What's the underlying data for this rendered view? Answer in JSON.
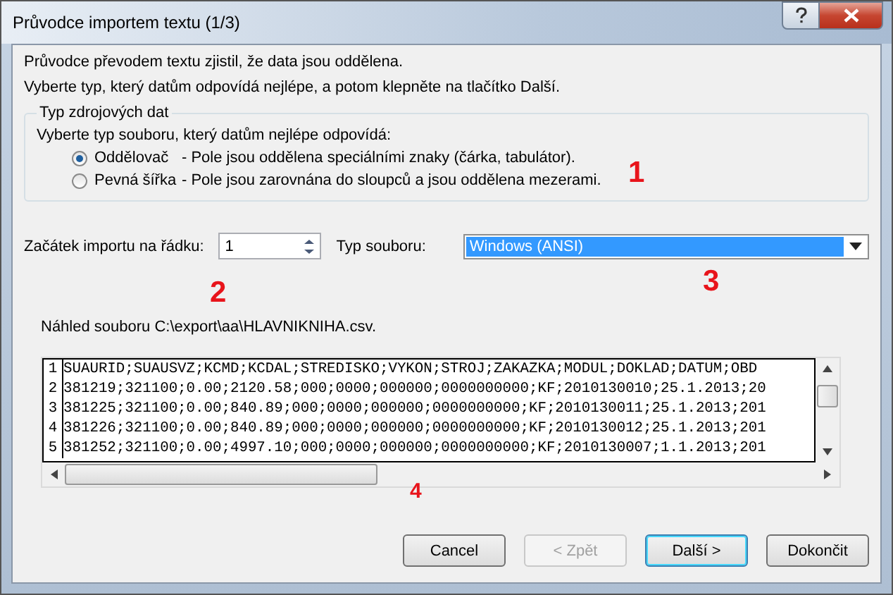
{
  "window": {
    "title": "Průvodce importem textu (1/3)"
  },
  "intro": [
    "Průvodce převodem textu zjistil, že data jsou oddělena.",
    "Vyberte typ, který datům odpovídá nejlépe, a potom klepněte na tlačítko Další."
  ],
  "source_group": {
    "legend": "Typ zdrojových dat",
    "prompt": "Vyberte typ souboru, který datům nejlépe odpovídá:",
    "options": [
      {
        "label": "Oddělovač",
        "description": "- Pole jsou oddělena speciálními znaky (čárka, tabulátor).",
        "selected": true
      },
      {
        "label": "Pevná šířka",
        "description": "- Pole jsou zarovnána do sloupců a jsou oddělena mezerami.",
        "selected": false
      }
    ]
  },
  "start_row": {
    "label": "Začátek importu na řádku:",
    "value": "1"
  },
  "file_type": {
    "label": "Typ souboru:",
    "value": "Windows (ANSI)"
  },
  "preview": {
    "label": "Náhled souboru C:\\export\\aa\\HLAVNIKNIHA.csv.",
    "lines": [
      {
        "number": "1",
        "text": "SUAURID;SUAUSVZ;KCMD;KCDAL;STREDISKO;VYKON;STROJ;ZAKAZKA;MODUL;DOKLAD;DATUM;OBD"
      },
      {
        "number": "2",
        "text": "381219;321100;0.00;2120.58;000;0000;000000;0000000000;KF;2010130010;25.1.2013;20"
      },
      {
        "number": "3",
        "text": "381225;321100;0.00;840.89;000;0000;000000;0000000000;KF;2010130011;25.1.2013;201"
      },
      {
        "number": "4",
        "text": "381226;321100;0.00;840.89;000;0000;000000;0000000000;KF;2010130012;25.1.2013;201"
      },
      {
        "number": "5",
        "text": "381252;321100;0.00;4997.10;000;0000;000000;0000000000;KF;2010130007;1.1.2013;201"
      }
    ]
  },
  "buttons": [
    {
      "label": "Cancel",
      "disabled": false,
      "default": false
    },
    {
      "label": "< Zpět",
      "disabled": true,
      "default": false
    },
    {
      "label": "Další >",
      "disabled": false,
      "default": true
    },
    {
      "label": "Dokončit",
      "disabled": false,
      "default": false
    }
  ],
  "annotations": [
    "1",
    "2",
    "3",
    "4"
  ]
}
